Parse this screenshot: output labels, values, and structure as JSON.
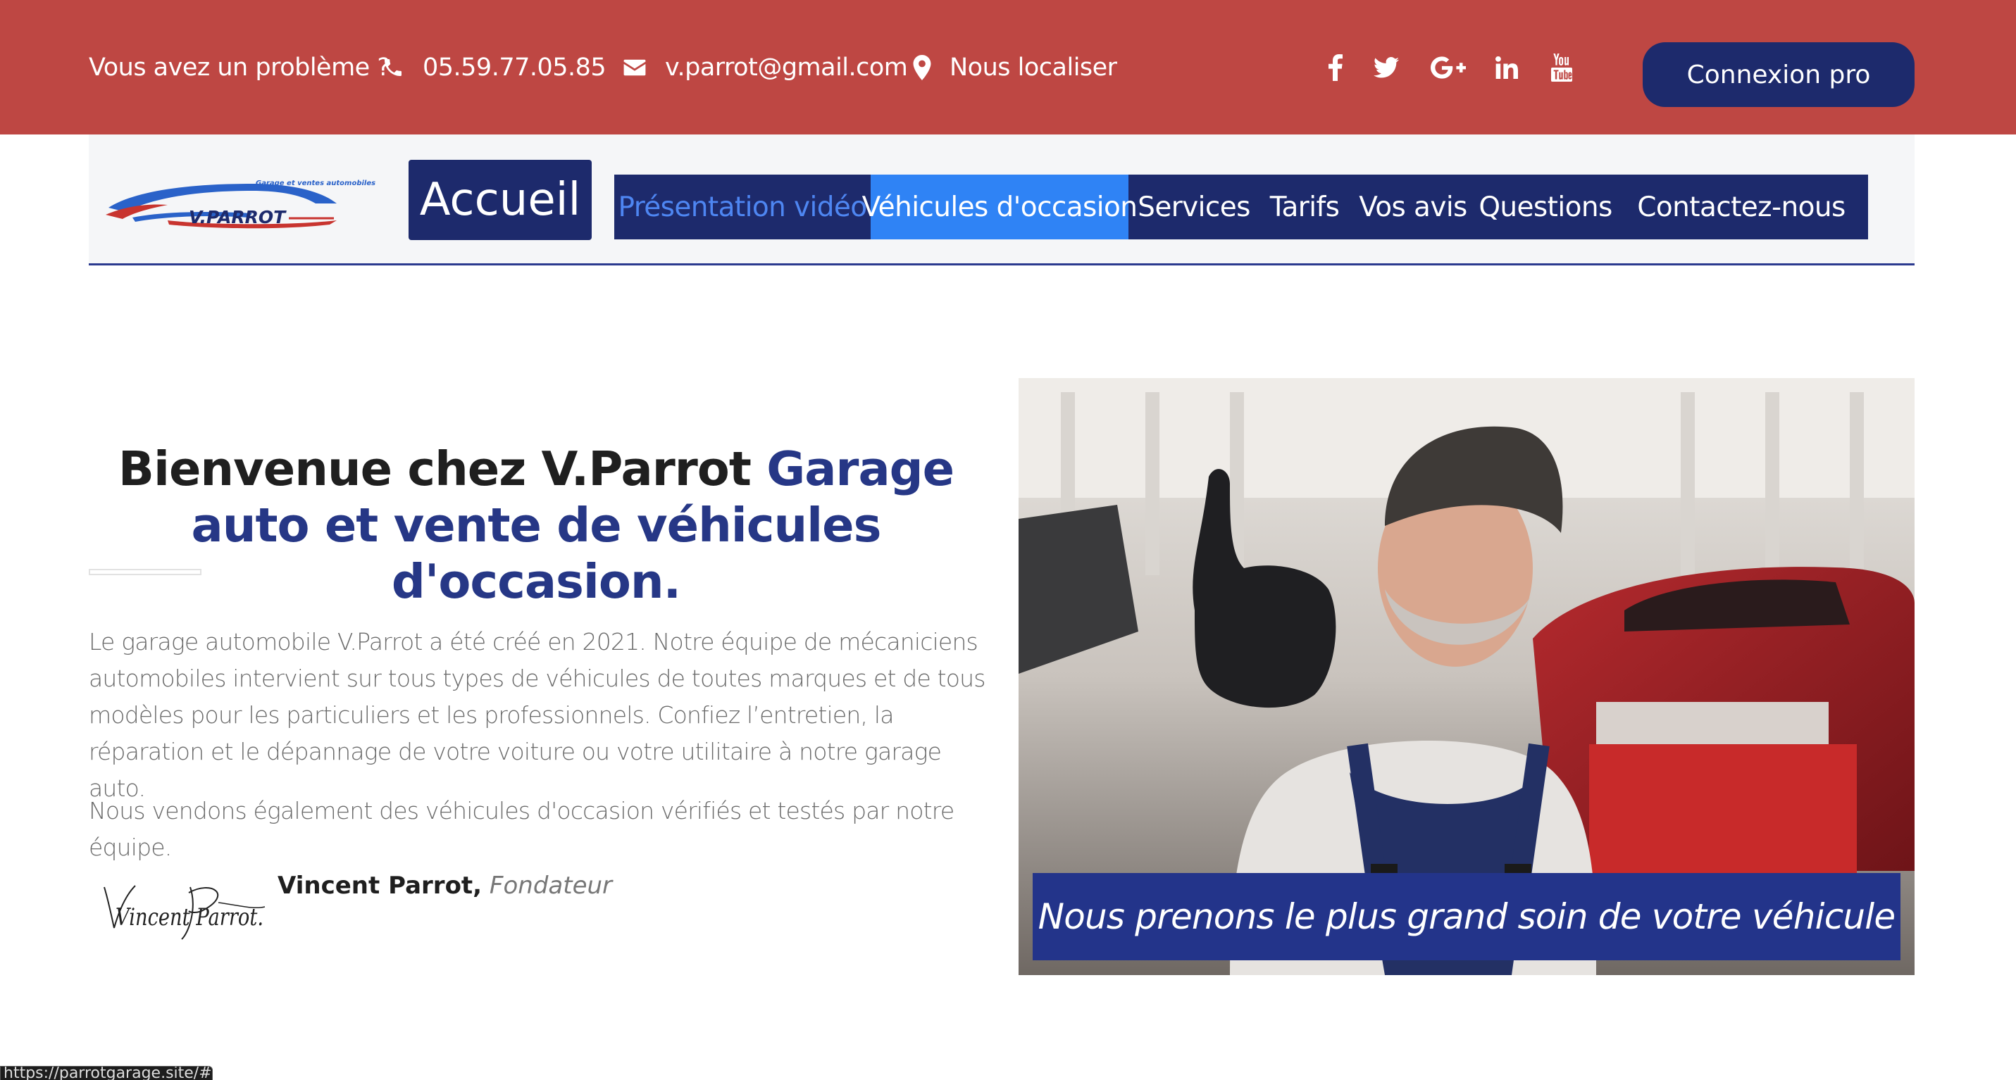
{
  "topbar": {
    "problem_label": "Vous avez un problème ?",
    "phone": "05.59.77.05.85",
    "email": "v.parrot@gmail.com",
    "locate": "Nous localiser",
    "social": [
      "facebook-icon",
      "twitter-icon",
      "google-plus-icon",
      "linkedin-icon",
      "youtube-icon"
    ],
    "pro_button": "Connexion pro",
    "bg_color": "#be4743",
    "button_color": "#1d2a6c"
  },
  "logo": {
    "tagline": "Garage et ventes automobiles",
    "brand": "V.PARROT"
  },
  "nav": {
    "home": "Accueil",
    "items": [
      {
        "label": "Présentation vidéo",
        "state": "link"
      },
      {
        "label": "Véhicules d'occasion",
        "state": "active"
      },
      {
        "label": "Services"
      },
      {
        "label": "Tarifs"
      },
      {
        "label": "Vos avis"
      },
      {
        "label": "Questions"
      },
      {
        "label": "Contactez-nous"
      }
    ],
    "menu_color": "#1d2a6c",
    "active_color": "#2f83f5"
  },
  "intro": {
    "title_dark": "Bienvenue chez V.Parrot",
    "title_blue": "Garage auto et vente de véhicules d'occasion.",
    "paragraph1": "Le garage automobile V.Parrot a été créé en 2021. Notre équipe de mécaniciens automobiles intervient sur tous types de véhicules de toutes marques et de tous modèles pour les particuliers et les professionnels. Confiez l’entretien, la réparation et le dépannage de votre voiture ou votre utilitaire à notre garage auto.",
    "paragraph2": "Nous vendons également des véhicules d'occasion vérifiés et testés par notre équipe.",
    "signer_name": "Vincent Parrot,",
    "signer_role": "Fondateur",
    "signature_text": "Vincent Parrot."
  },
  "hero_image": {
    "caption": "Nous prenons le plus grand soin de votre véhicule"
  },
  "status_bar": {
    "url": "https://parrotgarage.site/#"
  }
}
